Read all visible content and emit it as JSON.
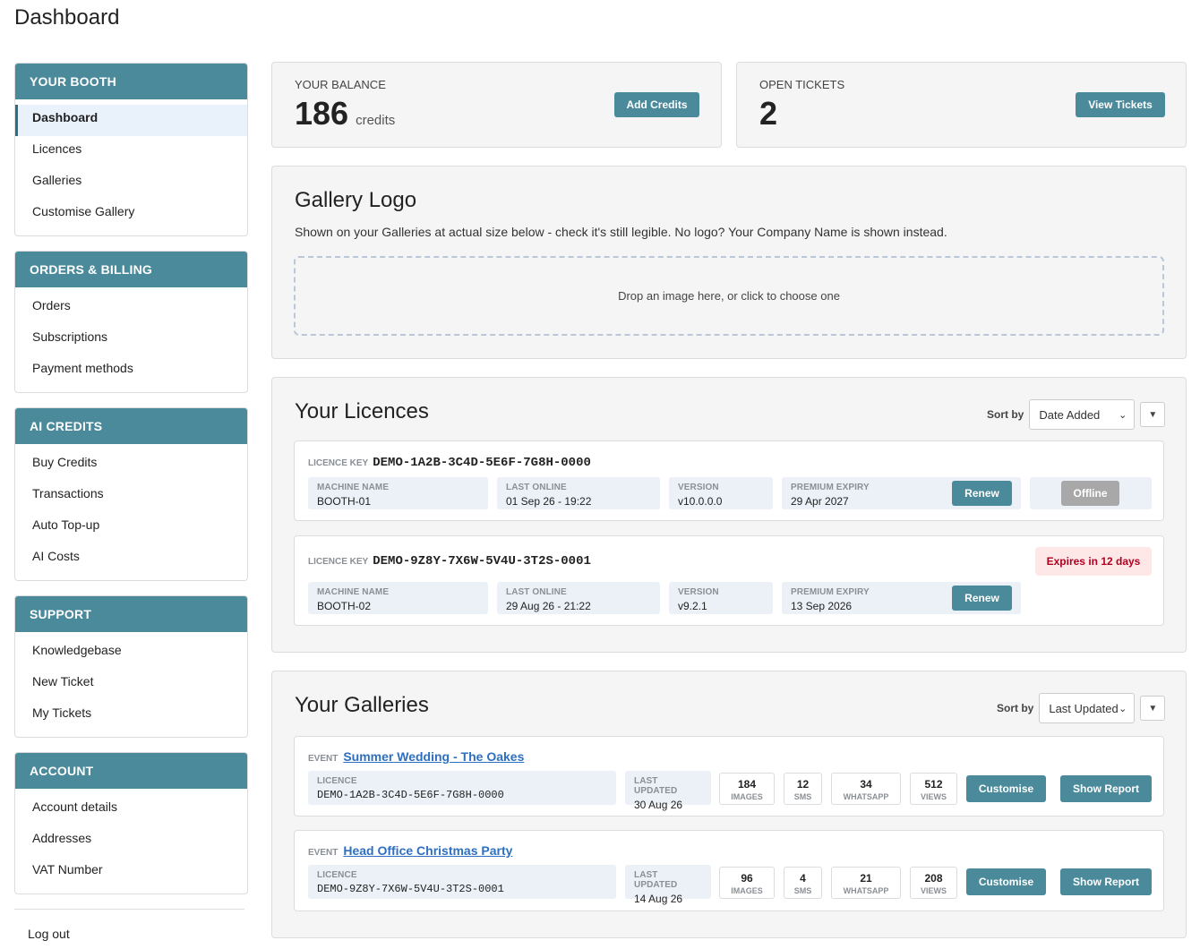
{
  "page": {
    "title": "Dashboard"
  },
  "sidebar": {
    "groups": [
      {
        "title": "YOUR BOOTH",
        "items": [
          "Dashboard",
          "Licences",
          "Galleries",
          "Customise Gallery"
        ]
      },
      {
        "title": "ORDERS & BILLING",
        "items": [
          "Orders",
          "Subscriptions",
          "Payment methods"
        ]
      },
      {
        "title": "AI CREDITS",
        "items": [
          "Buy Credits",
          "Transactions",
          "Auto Top-up",
          "AI Costs"
        ]
      },
      {
        "title": "SUPPORT",
        "items": [
          "Knowledgebase",
          "New Ticket",
          "My Tickets"
        ]
      },
      {
        "title": "ACCOUNT",
        "items": [
          "Account details",
          "Addresses",
          "VAT Number"
        ]
      }
    ],
    "logout": "Log out"
  },
  "balance": {
    "label": "YOUR BALANCE",
    "value": "186",
    "unit": "credits",
    "button": "Add Credits"
  },
  "tickets": {
    "label": "OPEN TICKETS",
    "value": "2",
    "button": "View Tickets"
  },
  "gallery_logo": {
    "title": "Gallery Logo",
    "description": "Shown on your Galleries at actual size below - check it's still legible. No logo? Your Company Name is shown instead.",
    "dropzone": "Drop an image here, or click to choose one"
  },
  "licences": {
    "title": "Your Licences",
    "sort_label": "Sort by",
    "sort_value": "Date Added",
    "key_label": "LICENCE KEY",
    "labels": {
      "machine": "MACHINE NAME",
      "online": "LAST ONLINE",
      "version": "VERSION",
      "expiry": "PREMIUM EXPIRY"
    },
    "renew": "Renew",
    "items": [
      {
        "key": "DEMO-1A2B-3C4D-5E6F-7G8H-0000",
        "machine": "BOOTH-01",
        "online": "01 Sep 26 - 19:22",
        "version": "v10.0.0.0",
        "expiry": "29 Apr 2027",
        "status": "Offline"
      },
      {
        "key": "DEMO-9Z8Y-7X6W-5V4U-3T2S-0001",
        "machine": "BOOTH-02",
        "online": "29 Aug 26 - 21:22",
        "version": "v9.2.1",
        "expiry": "13 Sep 2026",
        "badge": "Expires in 12 days"
      }
    ]
  },
  "galleries": {
    "title": "Your Galleries",
    "sort_label": "Sort by",
    "sort_value": "Last Updated",
    "event_label": "EVENT",
    "labels": {
      "licence": "LICENCE",
      "updated": "LAST UPDATED",
      "images": "IMAGES",
      "sms": "SMS",
      "whatsapp": "WHATSAPP",
      "views": "VIEWS"
    },
    "customise": "Customise",
    "report": "Show Report",
    "items": [
      {
        "event": "Summer Wedding - The Oakes",
        "licence": "DEMO-1A2B-3C4D-5E6F-7G8H-0000",
        "updated": "30 Aug 26",
        "images": "184",
        "sms": "12",
        "whatsapp": "34",
        "views": "512"
      },
      {
        "event": "Head Office Christmas Party",
        "licence": "DEMO-9Z8Y-7X6W-5V4U-3T2S-0001",
        "updated": "14 Aug 26",
        "images": "96",
        "sms": "4",
        "whatsapp": "21",
        "views": "208"
      }
    ]
  },
  "colors": {
    "accent": "#4a8a9b",
    "link": "#2d6fc0",
    "warn_bg": "#fde7e7",
    "warn_text": "#b00020"
  }
}
